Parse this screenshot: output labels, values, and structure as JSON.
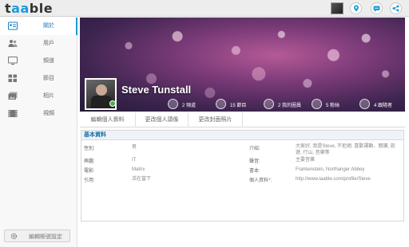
{
  "app": {
    "logo_pre": "t",
    "logo_mid": "aa",
    "logo_post": "ble"
  },
  "sidebar": {
    "items": [
      {
        "label": "關於",
        "icon": "profile-card-icon"
      },
      {
        "label": "用戶",
        "icon": "users-icon"
      },
      {
        "label": "頻道",
        "icon": "monitor-icon"
      },
      {
        "label": "節目",
        "icon": "grid-icon"
      },
      {
        "label": "相片",
        "icon": "photos-icon"
      },
      {
        "label": "視頻",
        "icon": "film-icon"
      }
    ],
    "settings_label": "編輯帳號設定"
  },
  "profile": {
    "name": "Steve Tunstall",
    "stats": [
      {
        "text": "2 頻道",
        "icon": "monitor-icon"
      },
      {
        "text": "15 節目",
        "icon": "grid-icon"
      },
      {
        "text": "2 我的圈員",
        "icon": "users-icon"
      },
      {
        "text": "5 粉絲",
        "icon": "add-user-icon"
      },
      {
        "text": "4 跟隨者",
        "icon": "follow-icon"
      }
    ]
  },
  "tabs": [
    "編輯個人資料",
    "更改個人頭像",
    "更改封面照片"
  ],
  "basic_info": {
    "title": "基本資料",
    "left": [
      {
        "label": "性別:",
        "value": "男"
      },
      {
        "label": "興趣:",
        "value": "IT"
      },
      {
        "label": "電影:",
        "value": "Matrix"
      },
      {
        "label": "引用:",
        "value": "活在當下"
      }
    ],
    "right": [
      {
        "label": "介紹:",
        "value": "大家好, 我是Steve, 不拒絕, 喜歡運動、閱讀, 旅遊, 行山, 音樂等"
      },
      {
        "label": "聲音:",
        "value": "主要音樂"
      },
      {
        "label": "書本:",
        "value": "Frankenstein, Northanger Abbey"
      },
      {
        "label": "個人資料*:",
        "value": "http://www.taable.com/profile/Steve"
      }
    ]
  },
  "colors": {
    "accent": "#1a9bd7",
    "online": "#4caf50"
  }
}
